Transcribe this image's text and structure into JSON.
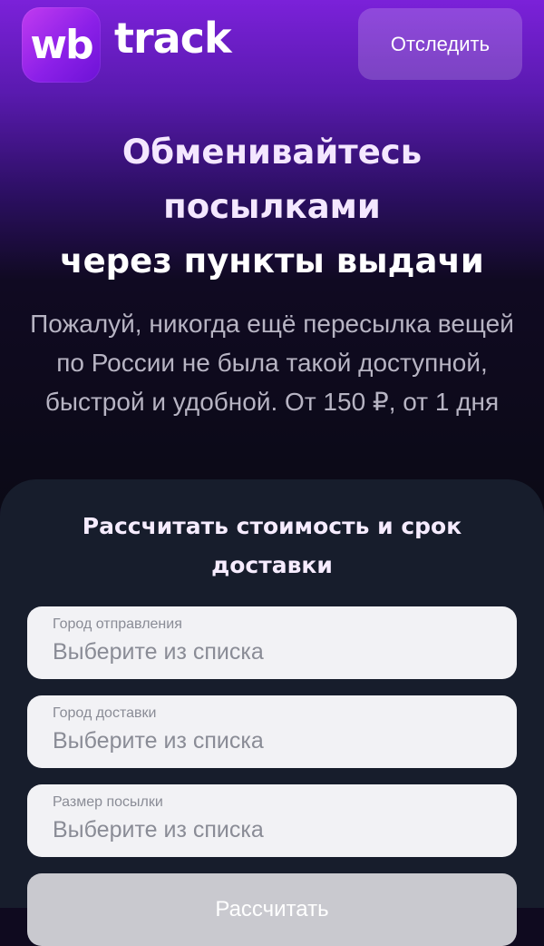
{
  "header": {
    "logo_wb": "wb",
    "logo_track": "track",
    "track_button_label": "Отследить"
  },
  "hero": {
    "title_lines": [
      "Обменивайтесь",
      "посылками",
      "через пункты выдачи"
    ],
    "subtitle": "Пожалуй, никогда ещё пересылка вещей по России не была такой доступной, быстрой и удобной. От 150 ₽, от 1 дня"
  },
  "calculator": {
    "title": "Рассчитать стоимость и срок доставки",
    "fields": [
      {
        "label": "Город отправления",
        "value": "Выберите из списка"
      },
      {
        "label": "Город доставки",
        "value": "Выберите из списка"
      },
      {
        "label": "Размер посылки",
        "value": "Выберите из списка"
      }
    ],
    "submit_label": "Рассчитать"
  },
  "colors": {
    "brand_purple": "#8c20e8",
    "card_background": "#171d2c",
    "field_background": "#f2f2f5"
  }
}
